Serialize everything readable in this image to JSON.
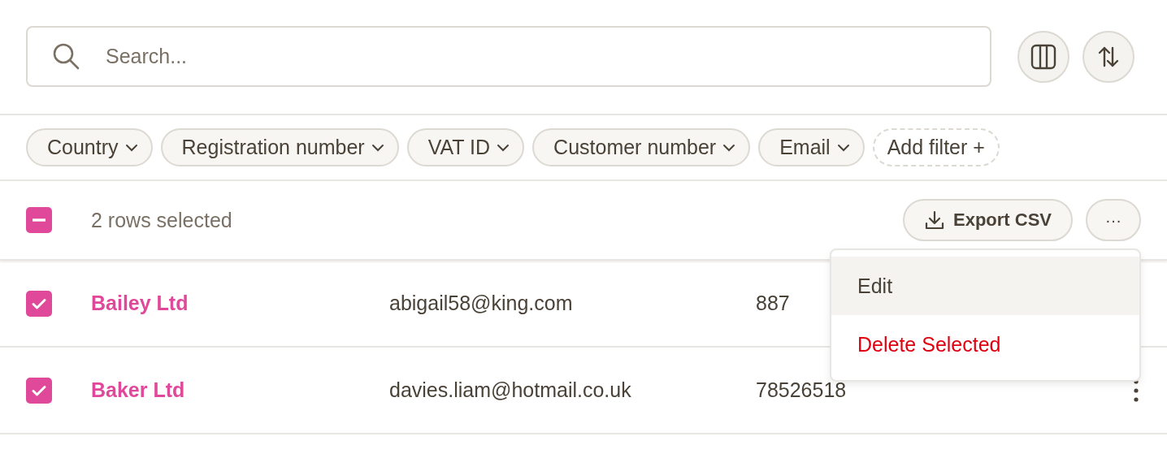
{
  "search": {
    "placeholder": "Search..."
  },
  "toolbar_buttons": [
    {
      "kind": "columns"
    },
    {
      "kind": "sort"
    }
  ],
  "filters": [
    {
      "label": "Country",
      "kind": "dropdown"
    },
    {
      "label": "Registration number",
      "kind": "dropdown"
    },
    {
      "label": "VAT ID",
      "kind": "dropdown"
    },
    {
      "label": "Customer number",
      "kind": "dropdown"
    },
    {
      "label": "Email",
      "kind": "dropdown"
    },
    {
      "label": "Add filter +",
      "kind": "add"
    }
  ],
  "selection": {
    "indeterminate": true,
    "label": "2 rows selected",
    "export_label": "Export CSV",
    "more_label": "···"
  },
  "rows": [
    {
      "checked": true,
      "name": "Bailey Ltd",
      "email": "abigail58@king.com",
      "number": "887"
    },
    {
      "checked": true,
      "name": "Baker Ltd",
      "email": "davies.liam@hotmail.co.uk",
      "number": "78526518",
      "actions_icon": true
    }
  ],
  "menu": {
    "items": [
      {
        "label": "Edit",
        "kind": "normal",
        "highlighted": true
      },
      {
        "label": "Delete Selected",
        "kind": "danger",
        "highlighted": false
      }
    ]
  }
}
